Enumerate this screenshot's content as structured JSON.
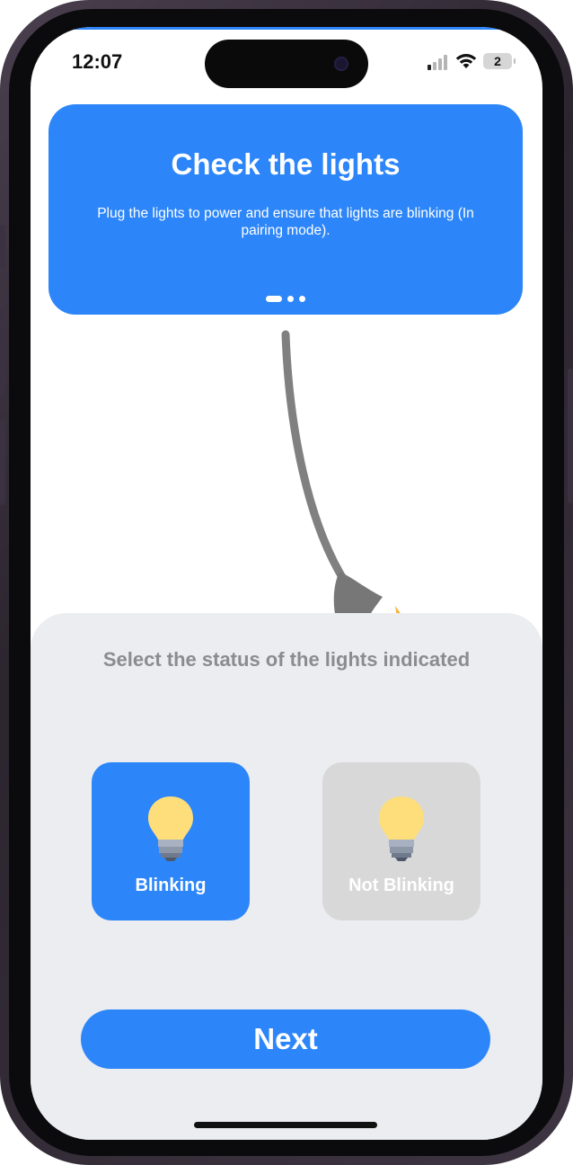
{
  "status_bar": {
    "time": "12:07",
    "battery_level": "2",
    "icons": [
      "signal-icon",
      "wifi-icon",
      "battery-icon"
    ]
  },
  "hero": {
    "title": "Check the lights",
    "description": "Plug the lights to power and ensure that lights are blinking (In pairing mode).",
    "page_count": 3,
    "active_page": 1
  },
  "sheet": {
    "title": "Select the status of the lights indicated",
    "options": [
      {
        "label": "Blinking",
        "icon": "lightbulb-icon",
        "selected": true
      },
      {
        "label": "Not Blinking",
        "icon": "lightbulb-icon",
        "selected": false
      }
    ],
    "next_label": "Next"
  },
  "colors": {
    "accent": "#2d86f9",
    "sheet_background": "#ebedf0",
    "unselected_option": "#d8d8d8",
    "bulb_yellow": "#fdde7a"
  }
}
